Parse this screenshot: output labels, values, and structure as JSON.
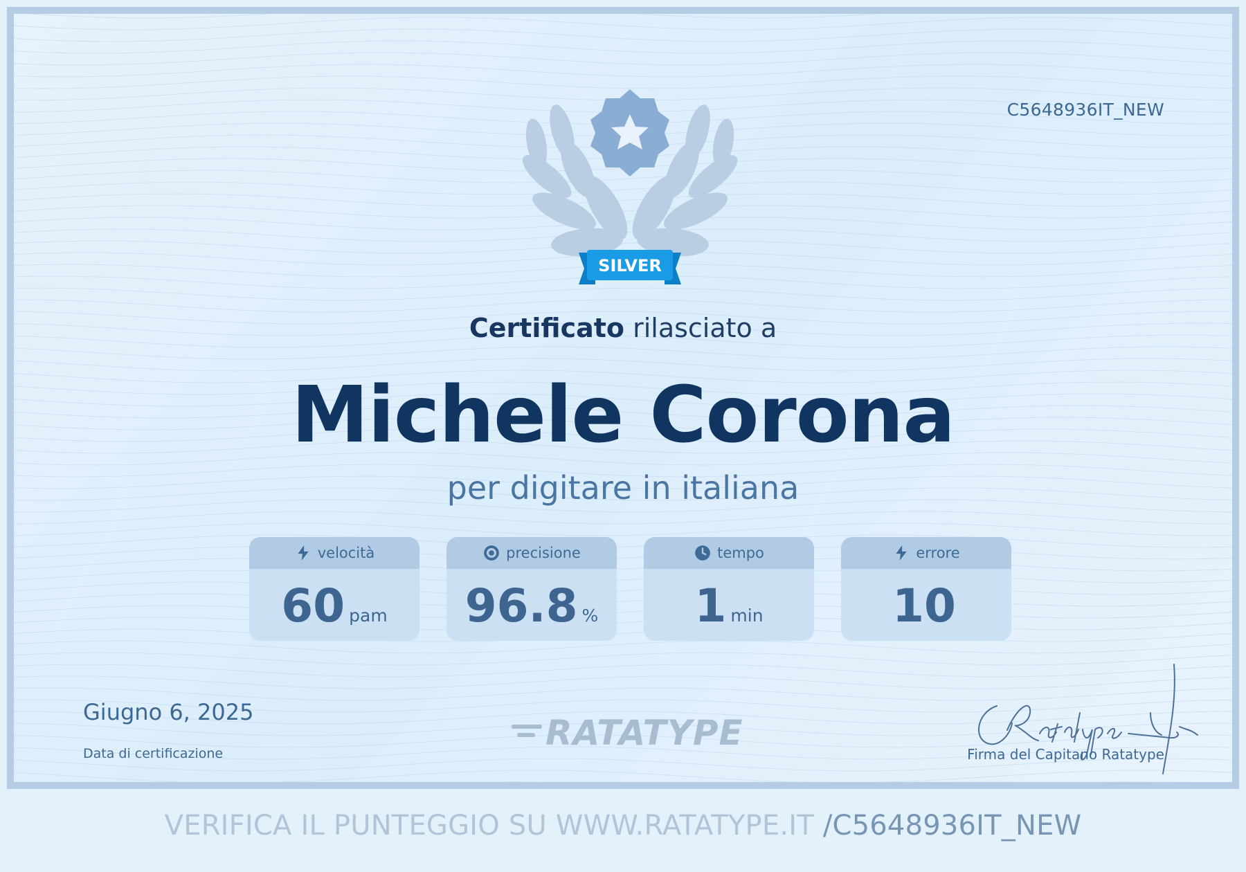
{
  "certificate": {
    "code": "C5648936IT_NEW",
    "badge_label": "SILVER",
    "issued_strong": "Certificato",
    "issued_rest": " rilasciato a",
    "recipient": "Michele Corona",
    "subject": "per digitare in italiana"
  },
  "stats": [
    {
      "icon": "lightning-icon",
      "label": "velocità",
      "value": "60",
      "unit": "pam"
    },
    {
      "icon": "target-icon",
      "label": "precisione",
      "value": "96.8",
      "unit": "%"
    },
    {
      "icon": "clock-icon",
      "label": "tempo",
      "value": "1",
      "unit": "min"
    },
    {
      "icon": "lightning-icon",
      "label": "errore",
      "value": "10",
      "unit": ""
    }
  ],
  "footer": {
    "date": "Giugno 6, 2025",
    "date_label": "Data di certificazione",
    "brand": "RATATYPE",
    "signature_label": "Firma del Capitano Ratatype",
    "verify_text": "VERIFICA IL PUNTEGGIO SU WWW.RATATYPE.IT ",
    "verify_code": "/C5648936IT_NEW"
  },
  "colors": {
    "background": "#e3f1fb",
    "border": "#b6cbe4",
    "name_text": "#0f3560",
    "badge_ribbon": "#1a9be6",
    "accent_text": "#3c6894"
  }
}
